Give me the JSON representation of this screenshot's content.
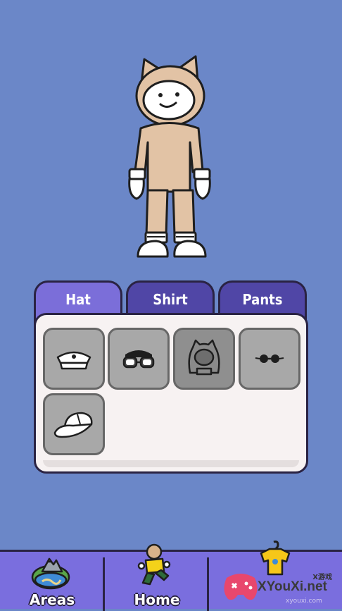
{
  "tabs": [
    {
      "label": "Hat",
      "active": true
    },
    {
      "label": "Shirt",
      "active": false
    },
    {
      "label": "Pants",
      "active": false
    }
  ],
  "items": [
    {
      "name": "sailor-cap-icon",
      "selected": false
    },
    {
      "name": "goggles-icon",
      "selected": false
    },
    {
      "name": "hood-icon",
      "selected": true
    },
    {
      "name": "round-sunglasses-icon",
      "selected": false
    },
    {
      "name": "baseball-cap-icon",
      "selected": false
    }
  ],
  "nav": [
    {
      "label": "Areas",
      "icon": "island-icon"
    },
    {
      "label": "Home",
      "icon": "running-character-icon"
    },
    {
      "label": "",
      "icon": "shirt-hanger-icon"
    }
  ],
  "watermark": {
    "brand": "XYouXi.net",
    "small": "X游戏",
    "url": "xyouxi.com"
  },
  "colors": {
    "background": "#6b87c8",
    "tab_active": "#7b6ed9",
    "tab_inactive": "#5046a6",
    "nav_bar": "#7a6ede"
  }
}
